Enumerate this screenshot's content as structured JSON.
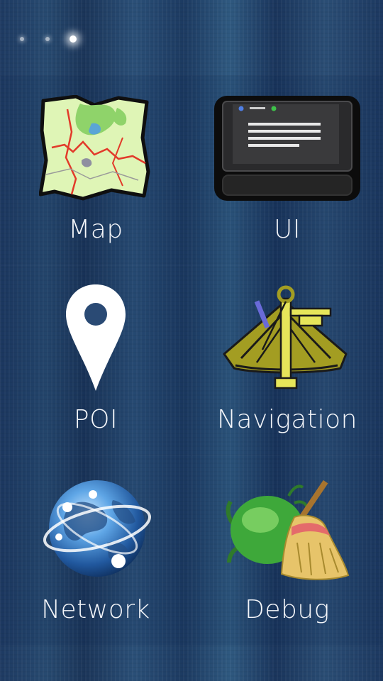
{
  "pager": {
    "pages": 3,
    "active_index": 2
  },
  "tiles": [
    {
      "label": "Map",
      "icon": "folded-map-icon"
    },
    {
      "label": "UI",
      "icon": "screen-window-icon"
    },
    {
      "label": "POI",
      "icon": "location-pin-icon"
    },
    {
      "label": "Navigation",
      "icon": "sextant-icon"
    },
    {
      "label": "Network",
      "icon": "globe-network-icon"
    },
    {
      "label": "Debug",
      "icon": "bug-broom-icon"
    }
  ],
  "colors": {
    "background": "#1e3a62",
    "label": "#f4f6fa",
    "map_land": "#d9f4b0",
    "map_forest": "#8fd36a",
    "sextant": "#b8b22a",
    "sextant_ruler": "#e6e55a",
    "bug_green": "#3ea83a",
    "broom_straw": "#e7c46a"
  }
}
